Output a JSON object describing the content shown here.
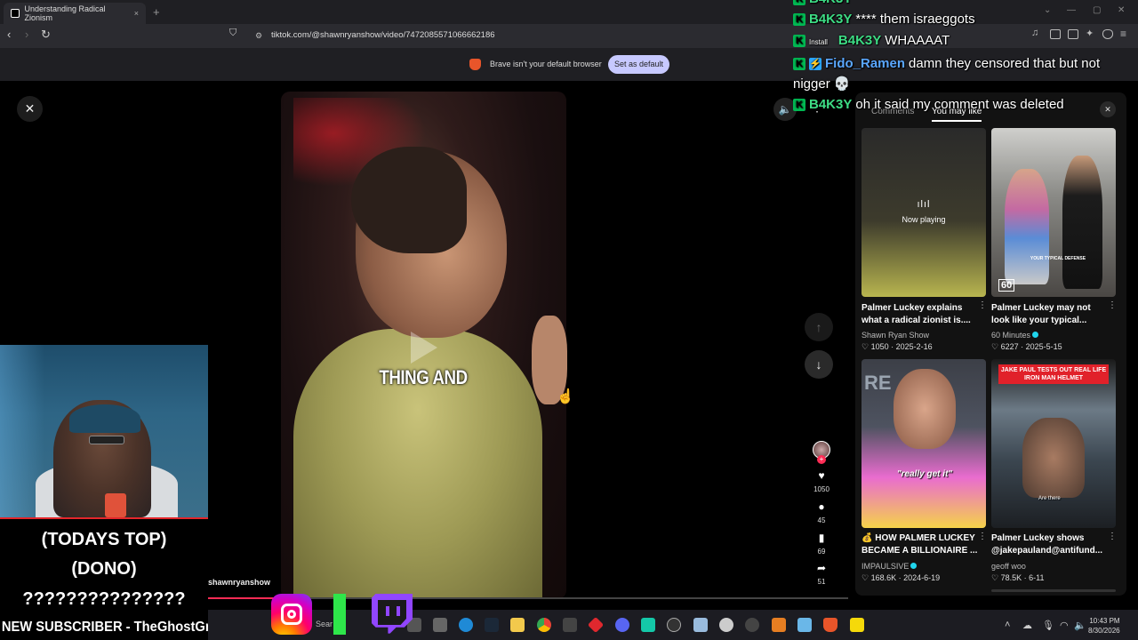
{
  "browser": {
    "tab_title": "Understanding Radical Zionism",
    "tab_close": "×",
    "new_tab": "+",
    "url": "tiktok.com/@shawnryanshow/video/7472085571066662186",
    "infobar_text": "Brave isn't your default browser",
    "set_default_label": "Set as default"
  },
  "video": {
    "caption": "THING AND",
    "creator_handle": "shawnryanshow",
    "close": "✕",
    "likes": "1050",
    "comments": "45",
    "saves": "69",
    "shares": "51"
  },
  "panel": {
    "tab_comments": "Comments",
    "tab_you_may_like": "You may like",
    "close": "✕",
    "videos": [
      {
        "title": "Palmer Luckey explains what a radical zionist is....",
        "channel": "Shawn Ryan Show",
        "likes": "1050",
        "date": "2025-2-16",
        "now_playing": "Now playing",
        "verified": false
      },
      {
        "title": "Palmer Luckey may not look like your typical...",
        "channel": "60 Minutes",
        "likes": "6227",
        "date": "2025-5-15",
        "verified": true,
        "overlay": "YOUR TYPICAL DEFENSE",
        "logo": "60"
      },
      {
        "title": "💰 HOW PALMER LUCKEY BECAME A BILLIONAIRE ...",
        "channel": "IMPAULSIVE",
        "likes": "168.6K",
        "date": "2024-6-19",
        "verified": true,
        "overlay": "\"really get it\""
      },
      {
        "title": "Palmer Luckey shows @jakepauland@antifund...",
        "channel": "geoff woo",
        "likes": "78.5K",
        "date": "6-11",
        "verified": false,
        "overlay": "JAKE PAUL TESTS OUT REAL LIFE IRON MAN HELMET",
        "overlay2": "Are there"
      }
    ]
  },
  "chat": [
    {
      "name": "B4K3Y",
      "message": "**** them israeggots",
      "badge": "K",
      "name_color": "#3ddc84"
    },
    {
      "name": "B4K3Y",
      "message": "WHAAAAT",
      "badge": "K",
      "name_color": "#3ddc84"
    },
    {
      "name": "Fido_Ramen",
      "message": "damn they censored that but not",
      "badge": "K",
      "name_color": "#5aa7ff",
      "continuation": "nigger 💀"
    },
    {
      "name": "B4K3Y",
      "message": "oh it said my comment was deleted",
      "badge": "K",
      "name_color": "#3ddc84"
    }
  ],
  "stream_overlay": {
    "todays_top": "(TODAYS TOP)",
    "dono": "(DONO)",
    "dono_value": "???????????????",
    "new_subscriber": "NEW SUBSCRIBER - TheGhostGmes"
  },
  "taskbar": {
    "search_label": "Sear",
    "time": "10:43 PM",
    "date": "8/30/2026"
  },
  "colors": {
    "tiktok_red": "#fe2c55",
    "brave_orange": "#e8552a",
    "set_default_bg": "#c7c9ff",
    "chat_green": "#3ddc84",
    "chat_blue": "#5aa7ff",
    "twitch_purple": "#9146ff"
  }
}
